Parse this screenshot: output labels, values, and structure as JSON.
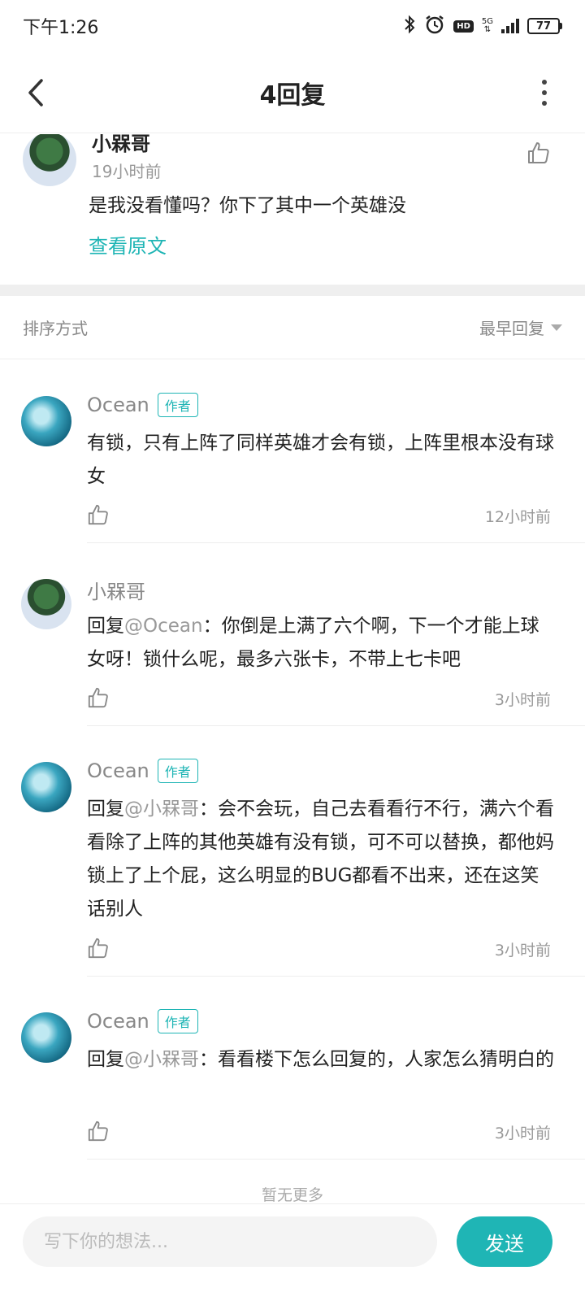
{
  "status_bar": {
    "time": "下午1:26",
    "network": "5G",
    "hd": "HD",
    "battery": "77"
  },
  "header": {
    "title": "4回复"
  },
  "original_comment": {
    "author": "小槑哥",
    "time": "19小时前",
    "text": "是我没看懂吗？你下了其中一个英雄没",
    "view_original": "查看原文"
  },
  "sort": {
    "label": "排序方式",
    "selected": "最早回复"
  },
  "replies": [
    {
      "author": "Ocean",
      "badge": "作者",
      "mention": "",
      "text": "有锁，只有上阵了同样英雄才会有锁，上阵里根本没有球女",
      "time": "12小时前"
    },
    {
      "author": "小槑哥",
      "badge": "",
      "mention": "@Ocean",
      "text": "：你倒是上满了六个啊，下一个才能上球女呀！锁什么呢，最多六张卡，不带上七卡吧",
      "time": "3小时前"
    },
    {
      "author": "Ocean",
      "badge": "作者",
      "mention": "@小槑哥",
      "text": "：会不会玩，自己去看看行不行，满六个看看除了上阵的其他英雄有没有锁，可不可以替换，都他妈锁上了上个屁，这么明显的BUG都看不出来，还在这笑话别人",
      "time": "3小时前"
    },
    {
      "author": "Ocean",
      "badge": "作者",
      "mention": "@小槑哥",
      "text": "：看看楼下怎么回复的，人家怎么猜明白的",
      "time": "3小时前"
    }
  ],
  "reply_prefix": "回复",
  "no_more": "暂无更多",
  "composer": {
    "placeholder": "写下你的想法...",
    "send_label": "发送"
  },
  "colors": {
    "accent": "#1fb5b5"
  }
}
